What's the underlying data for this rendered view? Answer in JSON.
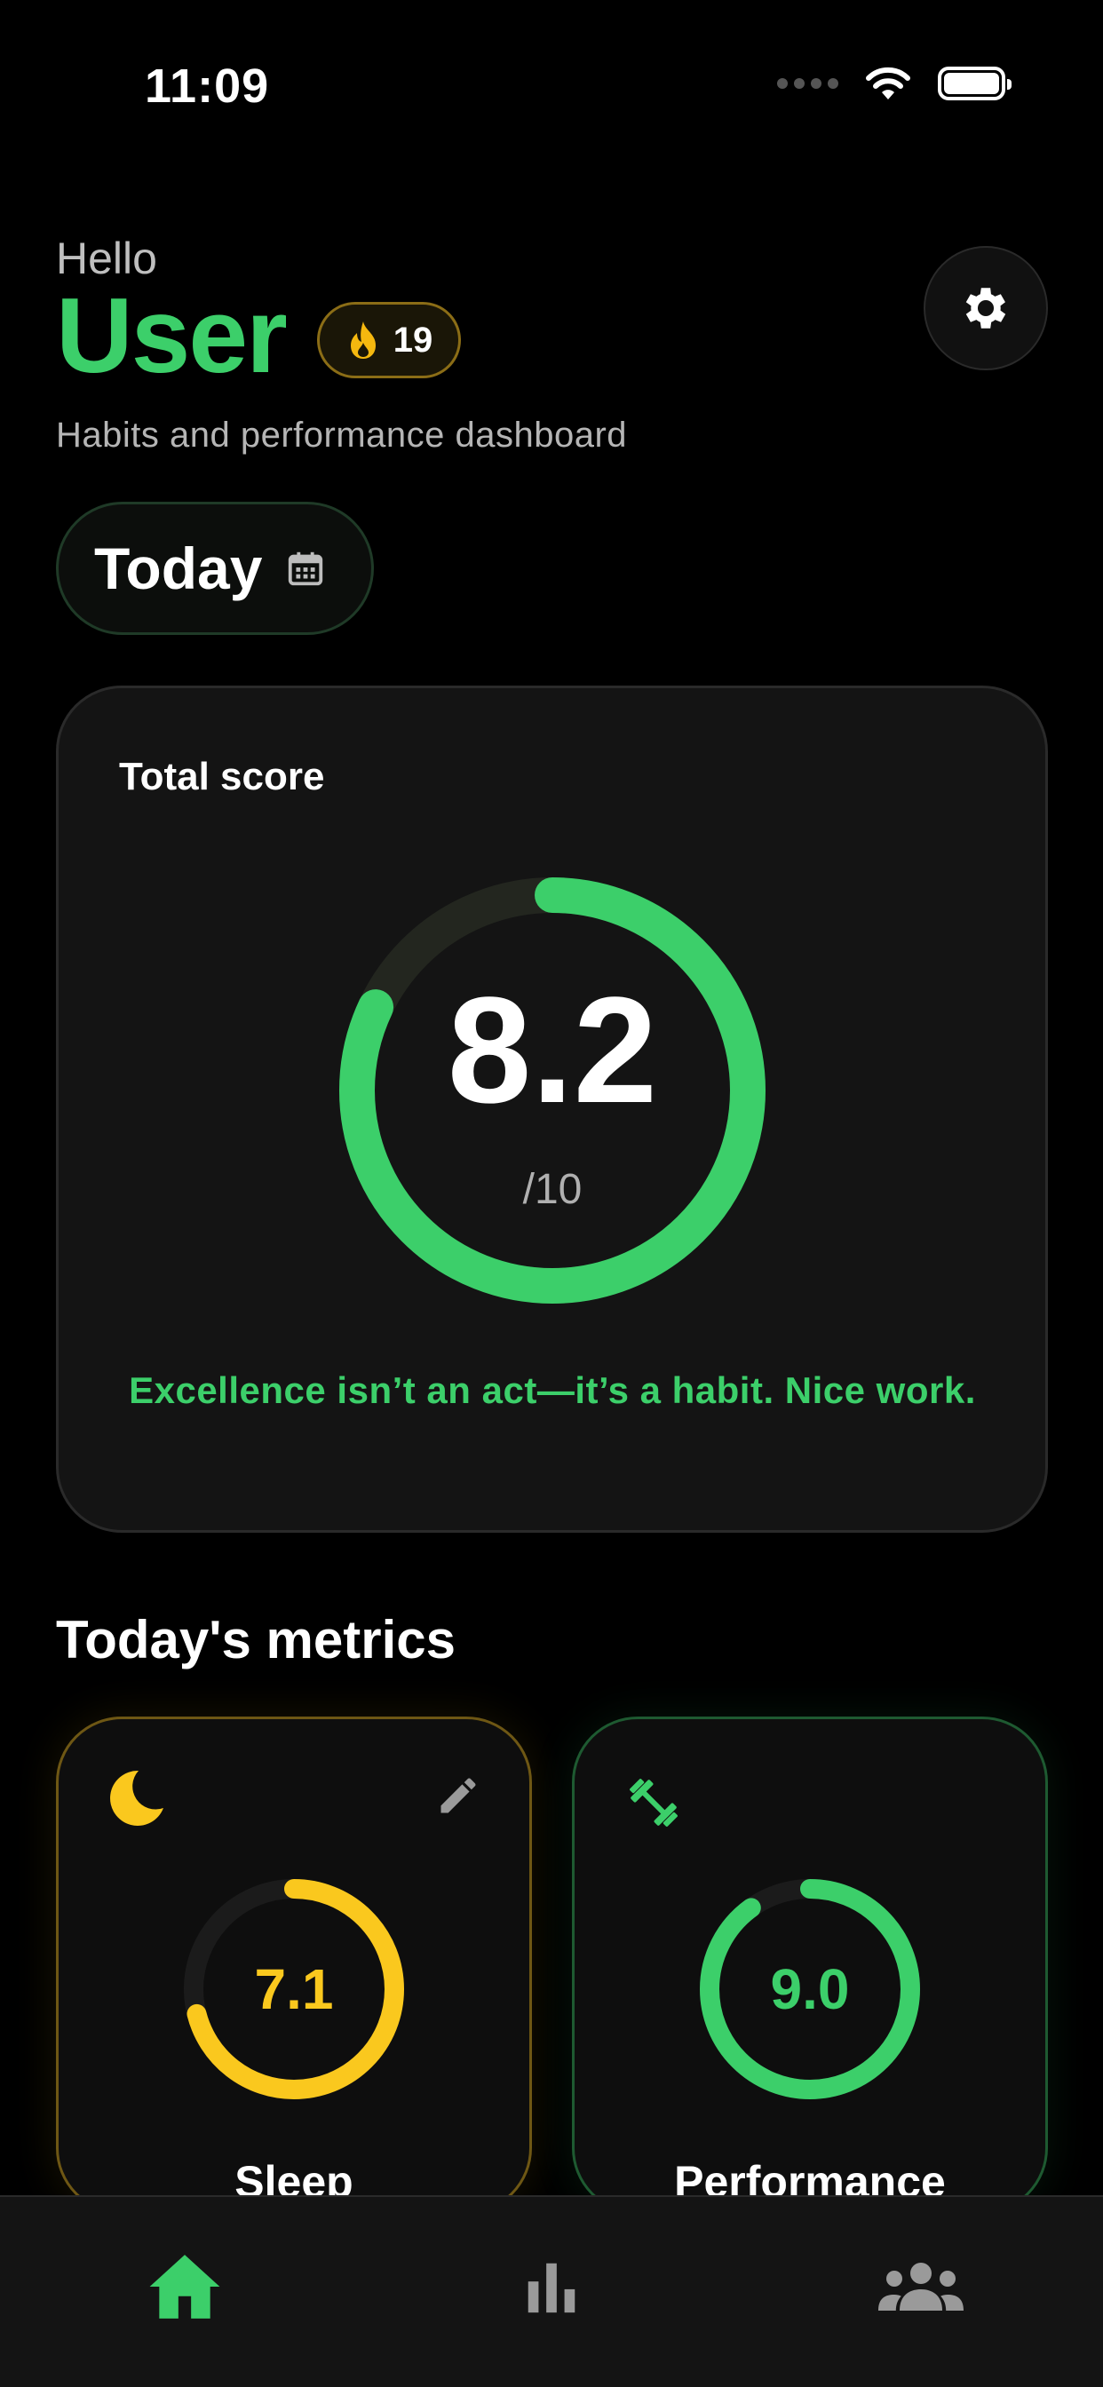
{
  "status_bar": {
    "time": "11:09"
  },
  "header": {
    "greeting": "Hello",
    "username": "User",
    "streak_count": "19",
    "subtitle": "Habits and performance dashboard"
  },
  "date_selector": {
    "label": "Today"
  },
  "total_score": {
    "title": "Total score",
    "value": "8.2",
    "max": "/10",
    "fraction": 0.82,
    "quote": "Excellence isn’t an act—it’s a habit. Nice work."
  },
  "metrics": {
    "title": "Today's metrics",
    "sleep": {
      "value": "7.1",
      "label": "Sleep",
      "fraction": 0.71
    },
    "performance": {
      "value": "9.0",
      "label": "Performance",
      "fraction": 0.9
    }
  },
  "colors": {
    "accent_green": "#3ccf6a",
    "accent_yellow": "#fac81e",
    "background": "#000000",
    "card": "#141414"
  },
  "nav": {
    "items": [
      {
        "icon": "home-icon",
        "active": true
      },
      {
        "icon": "bar-chart-icon",
        "active": false
      },
      {
        "icon": "group-icon",
        "active": false
      }
    ]
  }
}
